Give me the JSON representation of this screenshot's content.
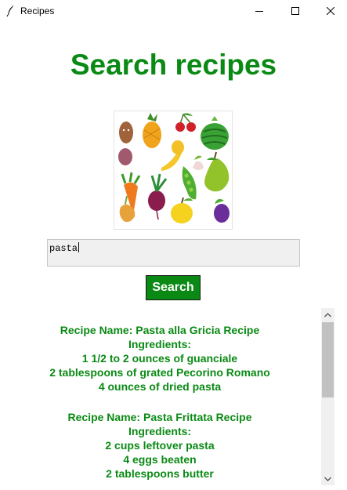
{
  "window": {
    "title": "Recipes",
    "icon": "feather-icon"
  },
  "main": {
    "heading": "Search recipes",
    "image": "vegetables-and-fruits-illustration",
    "search": {
      "value": "pasta"
    },
    "search_button": "Search"
  },
  "results": [
    {
      "lines": [
        "Recipe Name: Pasta alla Gricia Recipe",
        "Ingredients:",
        "1 1/2 to 2 ounces of guanciale",
        "2 tablespoons of grated Pecorino Romano",
        "4 ounces of dried pasta"
      ]
    },
    {
      "lines": [
        "Recipe Name: Pasta Frittata Recipe",
        "Ingredients:",
        "2 cups leftover pasta",
        "4 eggs beaten",
        "2 tablespoons butter"
      ]
    }
  ],
  "colors": {
    "accent": "#0a8a14",
    "field_bg": "#f0f0f0",
    "scroll_thumb": "#c1c1c1"
  }
}
